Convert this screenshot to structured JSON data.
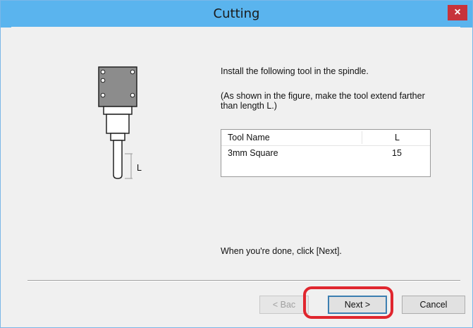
{
  "window": {
    "title": "Cutting",
    "close_label": "×"
  },
  "instructions": {
    "line1": "Install the following tool in the spindle.",
    "line2a": "(As shown in the figure, make the tool extend farther",
    "line2b": "than length L.)",
    "done": "When you're done, click [Next]."
  },
  "figure": {
    "length_label": "L"
  },
  "tool_table": {
    "headers": [
      "Tool Name",
      "L"
    ],
    "rows": [
      [
        "3mm Square",
        "15"
      ]
    ]
  },
  "buttons": {
    "back": "< Bac",
    "next": "Next >",
    "cancel": "Cancel"
  },
  "colors": {
    "titlebar": "#5ab4ee",
    "close": "#c7333b",
    "highlight": "#e0262e"
  }
}
